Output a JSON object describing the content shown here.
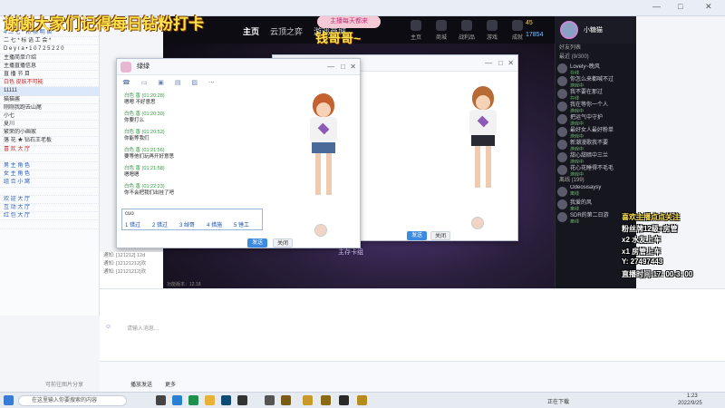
{
  "overlay_banner": "谢谢大家们记得每日钻粉打卡",
  "top_strip": {
    "controls": [
      "—",
      "□",
      "✕"
    ]
  },
  "left_panel": {
    "rows": [
      {
        "text": "4 二 七 * 粉 帧 明 目",
        "style": "blue"
      },
      {
        "text": "二 七 * 标 语 工 会 *",
        "style": ""
      },
      {
        "text": "D e y r a • 1 0 7 2 5 2 2 0",
        "style": ""
      },
      {
        "text": "主播简单介绍",
        "style": ""
      },
      {
        "text": "主播直播信息",
        "style": ""
      },
      {
        "text": "直 播 节 目",
        "style": ""
      },
      {
        "text": "白色 皮肤不可能",
        "style": "red"
      },
      {
        "text": "11111",
        "style": "hl"
      },
      {
        "text": "猫猫酱",
        "style": ""
      },
      {
        "text": "刚刚我跑去山尾",
        "style": ""
      },
      {
        "text": "小七",
        "style": ""
      },
      {
        "text": "夏川",
        "style": ""
      },
      {
        "text": "繁荣的小画家",
        "style": ""
      },
      {
        "text": "落 花 ★ 钻石王老板",
        "style": ""
      },
      {
        "text": "喜 欢 大 厅",
        "style": "red"
      },
      {
        "text": "",
        "style": ""
      },
      {
        "text": "男 主 角 色",
        "style": "blue"
      },
      {
        "text": "女 主 角 色",
        "style": "blue"
      },
      {
        "text": "组 合 小 窝",
        "style": "blue"
      },
      {
        "text": "",
        "style": ""
      },
      {
        "text": "欢 迎 大 厅",
        "style": "blue"
      },
      {
        "text": "互 动 大 厅",
        "style": "blue"
      },
      {
        "text": "红 包 大 厅",
        "style": "blue"
      },
      {
        "text": "",
        "style": ""
      }
    ]
  },
  "game": {
    "banner_title": "主播每天都来",
    "streamer_name": "钱哥哥~",
    "nav": [
      "主页",
      "云顶之弈",
      "游戏商城"
    ],
    "icons": [
      "主页",
      "商城",
      "战利品",
      "游戏",
      "成就"
    ],
    "currency": [
      "45",
      "17854"
    ],
    "profile_name": "小糖猫",
    "footer_version": "功能版本：12.18",
    "center_label": "主存卡组"
  },
  "friends": {
    "header": "好友列表",
    "groups": [
      {
        "label": "最近 (9/300)",
        "rows": [
          {
            "name": "Lovely~晚风",
            "status": "在线"
          },
          {
            "name": "你怎么来都喊不过",
            "status": "游戏中"
          },
          {
            "name": "我不要在那过",
            "status": "在线"
          },
          {
            "name": "我在等你一个人",
            "status": "游戏中"
          },
          {
            "name": "把运气中守护",
            "status": "游戏中"
          },
          {
            "name": "最好女人最好粉单",
            "status": "游戏中"
          },
          {
            "name": "新潮漫歌我不要",
            "status": "游戏中"
          },
          {
            "name": "甜心甜暗中三兰",
            "status": "游戏中"
          },
          {
            "name": "花心花睡得不毛毛",
            "status": "游戏中"
          }
        ]
      },
      {
        "label": "离线 (199)",
        "rows": [
          {
            "name": "Odeosisaysy",
            "status": "离线"
          },
          {
            "name": "我爱的风",
            "status": "离线"
          },
          {
            "name": "SDR的第二日游",
            "status": "离线"
          }
        ]
      }
    ]
  },
  "dialog1": {
    "title": "绿绿",
    "messages": [
      {
        "who": "白色 香 (01:20:28)",
        "text": "嗯嗯 不好意思"
      },
      {
        "who": "白色 香 (01:20:30)",
        "text": "你要打么"
      },
      {
        "who": "白色 香 (01:20:52)",
        "text": "你能等我们"
      },
      {
        "who": "白色 香 (01:21:56)",
        "text": "要等他们玩再开好意思"
      },
      {
        "who": "白色 香 (01:21:58)",
        "text": "嗯嗯嗯"
      },
      {
        "who": "白色 香 (01:22:23)",
        "text": "你不会把我们出挂了吧"
      }
    ],
    "input_value": "cuo",
    "ime_candidates": [
      "1 错过",
      "2 错过",
      "3 绰哥",
      "4 措施",
      "5 锉工"
    ],
    "send_label": "发送",
    "close_label": "关闭"
  },
  "dialog2": {
    "title": "绿绿",
    "send_label": "发送",
    "close_label": "关闭"
  },
  "gift_overlay": {
    "header": "喜欢主播点点关注",
    "lines": [
      "粉丝牌12级+房管",
      "x2 水友上车",
      "x1 房管上车",
      "Y: 27497443",
      "直播时间:17: 00-3: 00"
    ]
  },
  "sys_messages": [
    "通知: [121212] 12d",
    "通知: [12121212]欢",
    "通知: [12121212]欢"
  ],
  "lower_chat": {
    "input_placeholder": "请输入消息..."
  },
  "bottom_bar": {
    "items": [
      "可前往图片分享",
      "播放发送",
      "更多"
    ]
  },
  "taskbar": {
    "search_placeholder": "在这里输入你要搜索的内容",
    "tray_text": "正在下载",
    "time": "1:23",
    "date": "2022/9/25"
  }
}
